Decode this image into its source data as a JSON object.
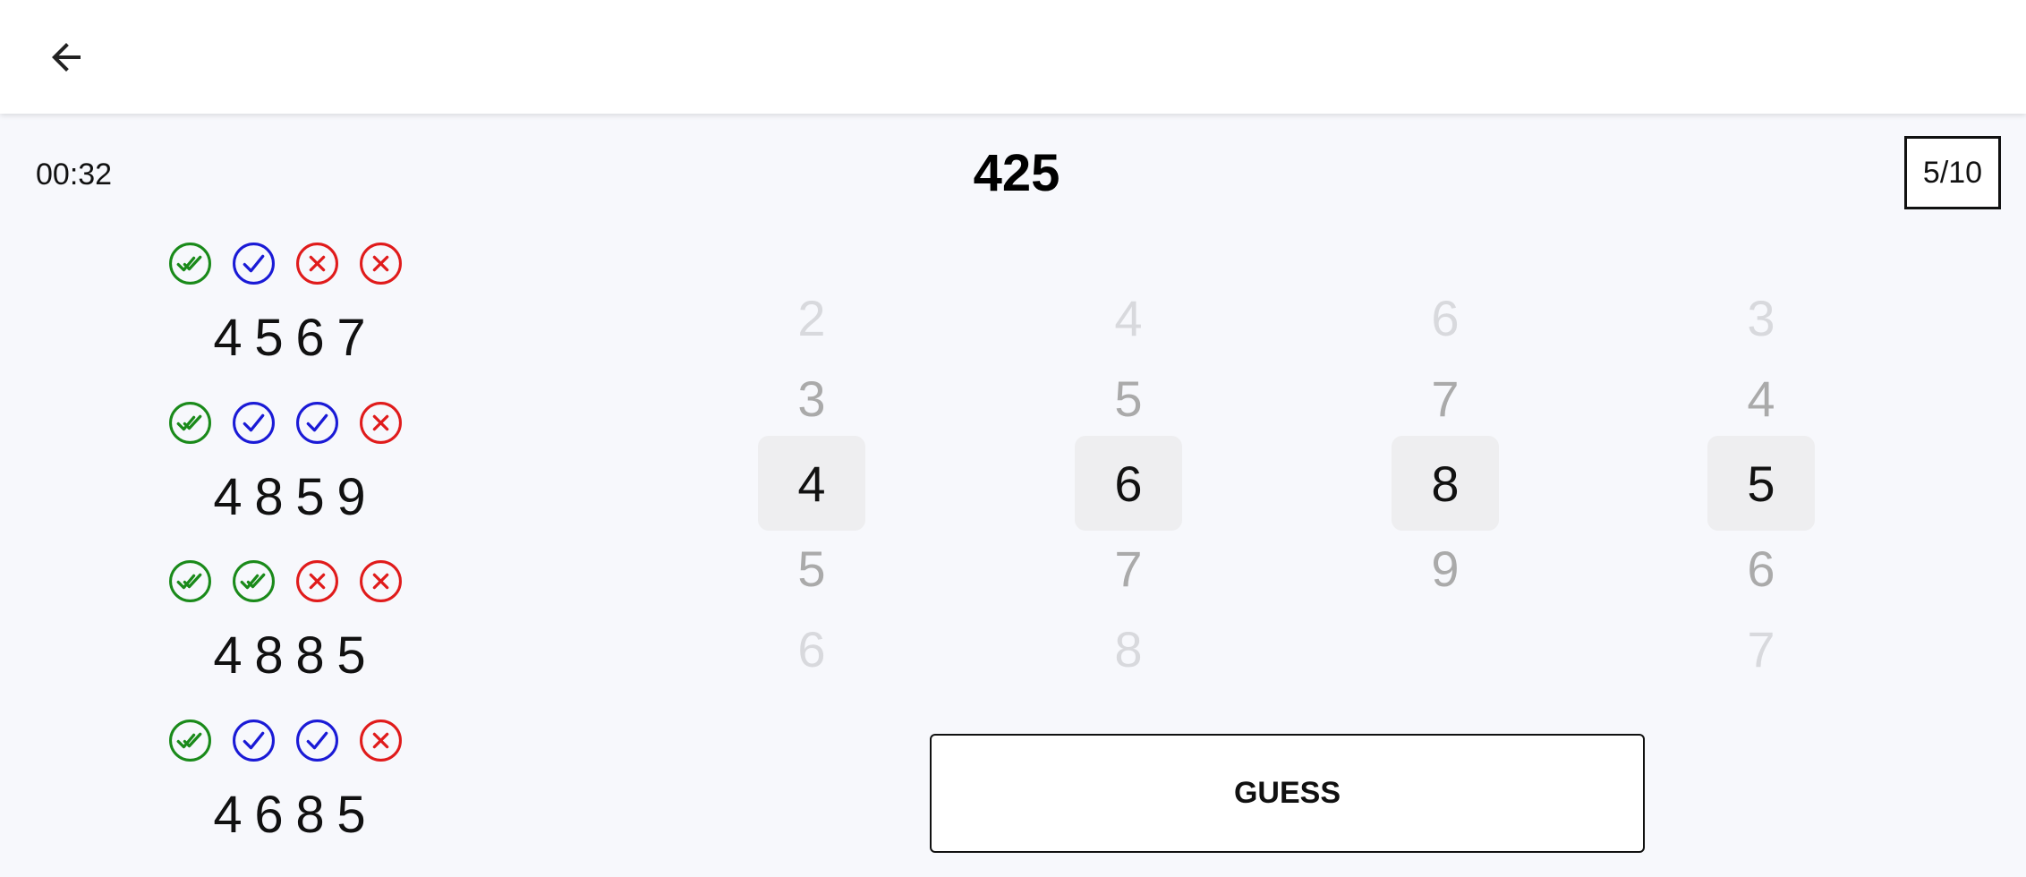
{
  "header": {
    "back_icon": "arrow-left-icon"
  },
  "status": {
    "timer": "00:32",
    "target": "425",
    "round": "5/10"
  },
  "colors": {
    "correct": "#1a8a1a",
    "misplaced": "#1a1ad6",
    "wrong": "#e01b1b"
  },
  "history": [
    {
      "marks": [
        "correct",
        "misplaced",
        "wrong",
        "wrong"
      ],
      "digits": [
        "4",
        "5",
        "6",
        "7"
      ]
    },
    {
      "marks": [
        "correct",
        "misplaced",
        "misplaced",
        "wrong"
      ],
      "digits": [
        "4",
        "8",
        "5",
        "9"
      ]
    },
    {
      "marks": [
        "correct",
        "correct",
        "wrong",
        "wrong"
      ],
      "digits": [
        "4",
        "8",
        "8",
        "5"
      ]
    },
    {
      "marks": [
        "correct",
        "misplaced",
        "misplaced",
        "wrong"
      ],
      "digits": [
        "4",
        "6",
        "8",
        "5"
      ]
    }
  ],
  "pickers": [
    {
      "above2": "2",
      "above1": "3",
      "selected": "4",
      "below1": "5",
      "below2": "6"
    },
    {
      "above2": "4",
      "above1": "5",
      "selected": "6",
      "below1": "7",
      "below2": "8"
    },
    {
      "above2": "6",
      "above1": "7",
      "selected": "8",
      "below1": "9",
      "below2": ""
    },
    {
      "above2": "3",
      "above1": "4",
      "selected": "5",
      "below1": "6",
      "below2": "7"
    }
  ],
  "actions": {
    "guess_label": "GUESS"
  }
}
